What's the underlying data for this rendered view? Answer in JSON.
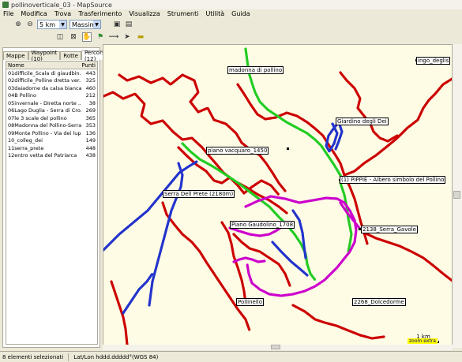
{
  "window": {
    "title": "pollinoverticale_03 - MapSource"
  },
  "menu": [
    "File",
    "Modifica",
    "Trova",
    "Trasferimento",
    "Visualizza",
    "Strumenti",
    "Utilità",
    "Guida"
  ],
  "toolbar": {
    "scale_value": "5 km",
    "detail_value": "Massimo"
  },
  "tabs": [
    {
      "label": "Mappe",
      "active": false
    },
    {
      "label": "Waypoint (10)",
      "active": false
    },
    {
      "label": "Rotte",
      "active": false
    },
    {
      "label": "Percorsi (12)",
      "active": true
    }
  ],
  "table": {
    "headers": {
      "name": "Nome",
      "points": "Punti"
    },
    "rows": [
      {
        "name": "01difficile_Scala di giaudbin...",
        "points": "443"
      },
      {
        "name": "02difficile_Polline dretta ver...",
        "points": "325"
      },
      {
        "name": "03daiadorne da calsa bianca",
        "points": "460"
      },
      {
        "name": "04B Pollino",
        "points": "212"
      },
      {
        "name": "05invernale - Diretta norte ...",
        "points": "38"
      },
      {
        "name": "06Lago Duglia - Serra di Cro...",
        "points": "269"
      },
      {
        "name": "07le 3 scale del pollino",
        "points": "365"
      },
      {
        "name": "08Madonna del Pollino-Serra...",
        "points": "353"
      },
      {
        "name": "09Monte Pollino - Via dei lupi",
        "points": "136"
      },
      {
        "name": "10_colleg_dei",
        "points": "149"
      },
      {
        "name": "11serra_prete",
        "points": "448"
      },
      {
        "name": "12entro vetta del Patriarca",
        "points": "438"
      }
    ]
  },
  "map_labels": [
    "madonna di pollino",
    "ingo_deglis",
    "Giardino degli Dei",
    "piano vacquaro_1450",
    "(1) PIPPIE - Albero simbolo del Pollino",
    "Serra Dell Prete (2180m)",
    "2138_Serra_Gavole",
    "Piano Gaudolino_1708",
    "Pollinello",
    "2268_Dolcedorme"
  ],
  "scale": {
    "label": "1 km",
    "zoom_note": "zoom extra"
  },
  "status": {
    "selection": "8 elementi selezionati",
    "coords": "Lat/Lon hddd.ddddd°(WGS 84)"
  },
  "colors": {
    "red": "#cc0000",
    "green": "#22cc22",
    "blue": "#2233cc",
    "magenta": "#cc00cc"
  }
}
